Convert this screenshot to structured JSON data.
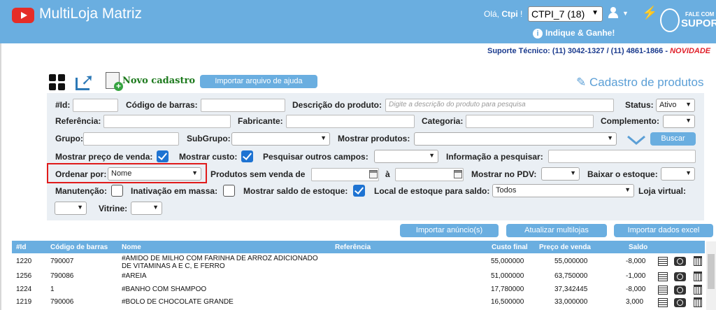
{
  "header": {
    "app_title": "MultiLoja Matriz",
    "greeting_prefix": "Olá,",
    "user_name": "Ctpi",
    "greeting_suffix": "!",
    "store_select": "CTPI_7 (18)",
    "indique_label": "Indique & Ganhe!",
    "support_top": "FALE COM",
    "support_main": "SUPORTE",
    "support_line": "Suporte Técnico: (11) 3042-1327 / (11) 4861-1866 - ",
    "support_novidade": "NOVIDADE"
  },
  "toolbar": {
    "novo_cadastro": "Novo cadastro",
    "importar_ajuda": "Importar arquivo de ajuda",
    "page_title": "Cadastro de produtos"
  },
  "filters": {
    "id_label": "#Id:",
    "codigo_barras_label": "Código de barras:",
    "descricao_label": "Descrição do produto:",
    "descricao_placeholder": "Digite a descrição do produto para pesquisa",
    "status_label": "Status:",
    "status_value": "Ativo",
    "referencia_label": "Referência:",
    "fabricante_label": "Fabricante:",
    "categoria_label": "Categoria:",
    "complemento_label": "Complemento:",
    "grupo_label": "Grupo:",
    "subgrupo_label": "SubGrupo:",
    "mostrar_produtos_label": "Mostrar produtos:",
    "buscar_label": "Buscar",
    "mostrar_preco_label": "Mostrar preço de venda:",
    "mostrar_custo_label": "Mostrar custo:",
    "pesquisar_outros_label": "Pesquisar outros campos:",
    "informacao_label": "Informação a pesquisar:",
    "ordenar_label": "Ordenar por:",
    "ordenar_value": "Nome",
    "sem_venda_label": "Produtos sem venda de",
    "a_label": "à",
    "mostrar_pdv_label": "Mostrar no PDV:",
    "baixar_estoque_label": "Baixar o estoque:",
    "manutencao_label": "Manutenção:",
    "inativacao_label": "Inativação em massa:",
    "mostrar_saldo_label": "Mostrar saldo de estoque:",
    "local_estoque_label": "Local de estoque para saldo:",
    "local_estoque_value": "Todos",
    "loja_virtual_label": "Loja virtual:",
    "vitrine_label": "Vitrine:",
    "mostrar_preco_checked": true,
    "mostrar_custo_checked": true,
    "manutencao_checked": false,
    "inativacao_checked": false,
    "mostrar_saldo_checked": true
  },
  "actions": {
    "importar_anuncio": "Importar anúncio(s)",
    "atualizar_multilojas": "Atualizar multilojas",
    "importar_excel": "Importar dados excel"
  },
  "table": {
    "columns": [
      "#Id",
      "Código de barras",
      "Nome",
      "Referência",
      "Custo final",
      "Preço de venda",
      "Saldo"
    ],
    "rows": [
      {
        "id": "1220",
        "barcode": "790007",
        "name1": "#AMIDO DE MILHO COM FARINHA DE ARROZ ADICIONADO",
        "name2": "DE VITAMINAS A E C, E FERRO",
        "ref": "",
        "custo": "55,000000",
        "preco": "55,000000",
        "saldo": "-8,000"
      },
      {
        "id": "1256",
        "barcode": "790086",
        "name1": "#AREIA",
        "name2": "",
        "ref": "",
        "custo": "51,000000",
        "preco": "63,750000",
        "saldo": "-1,000"
      },
      {
        "id": "1224",
        "barcode": "1",
        "name1": "#BANHO COM SHAMPOO",
        "name2": "",
        "ref": "",
        "custo": "17,780000",
        "preco": "37,342445",
        "saldo": "-8,000"
      },
      {
        "id": "1219",
        "barcode": "790006",
        "name1": "#BOLO DE CHOCOLATE GRANDE",
        "name2": "",
        "ref": "",
        "custo": "16,500000",
        "preco": "33,000000",
        "saldo": "3,000"
      }
    ]
  },
  "icons": {
    "row_actions": [
      "list-icon",
      "camera-icon",
      "trash-icon"
    ],
    "accent_color": "#6aaee0",
    "highlight_color": "#e01b1b"
  }
}
